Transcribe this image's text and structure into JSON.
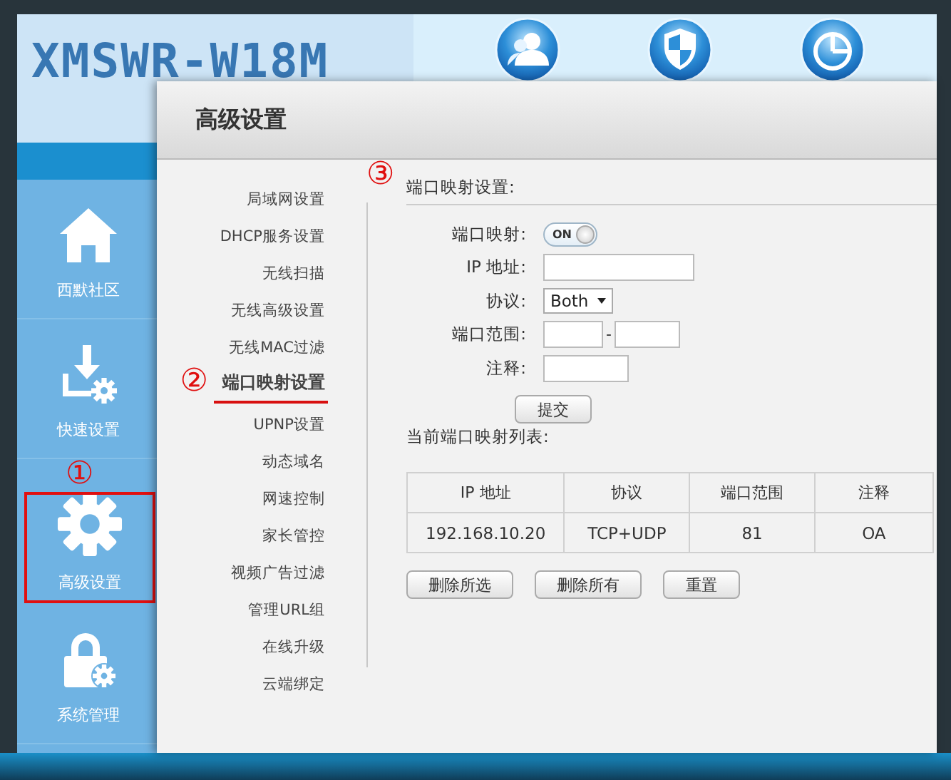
{
  "header": {
    "title": "XMSWR-W18M"
  },
  "sidebar": {
    "items": [
      {
        "label": "西默社区",
        "kind": "home",
        "highlighted": false
      },
      {
        "label": "快速设置",
        "kind": "quick",
        "highlighted": false
      },
      {
        "label": "高级设置",
        "kind": "advanced",
        "highlighted": true,
        "marker": "①"
      },
      {
        "label": "系统管理",
        "kind": "system",
        "highlighted": false
      }
    ]
  },
  "dialog": {
    "title": "高级设置",
    "menu": [
      {
        "label": "局域网设置",
        "selected": false
      },
      {
        "label": "DHCP服务设置",
        "selected": false
      },
      {
        "label": "无线扫描",
        "selected": false
      },
      {
        "label": "无线高级设置",
        "selected": false
      },
      {
        "label": "无线MAC过滤",
        "selected": false
      },
      {
        "label": "端口映射设置",
        "selected": true,
        "marker": "②"
      },
      {
        "label": "UPNP设置",
        "selected": false
      },
      {
        "label": "动态域名",
        "selected": false
      },
      {
        "label": "网速控制",
        "selected": false
      },
      {
        "label": "家长管控",
        "selected": false
      },
      {
        "label": "视频广告过滤",
        "selected": false
      },
      {
        "label": "管理URL组",
        "selected": false
      },
      {
        "label": "在线升级",
        "selected": false
      },
      {
        "label": "云端绑定",
        "selected": false
      }
    ],
    "section": {
      "title": "端口映射设置:",
      "marker": "③",
      "fields": [
        {
          "kind": "toggle",
          "label": "端口映射:",
          "on": true,
          "text": "ON"
        },
        {
          "kind": "text",
          "label": "IP 地址:"
        },
        {
          "kind": "select",
          "label": "协议:",
          "value": "Both"
        },
        {
          "kind": "range",
          "label": "端口范围:",
          "separator": "-"
        },
        {
          "kind": "short_text",
          "label": "注释:"
        }
      ],
      "submit": "提交"
    },
    "list_title": "当前端口映射列表:",
    "table": {
      "columns": [
        "IP 地址",
        "协议",
        "端口范围",
        "注释"
      ],
      "rows": [
        [
          "192.168.10.20",
          "TCP+UDP",
          "81",
          "OA"
        ]
      ]
    },
    "buttons": [
      "删除所选",
      "删除所有",
      "重置"
    ]
  }
}
